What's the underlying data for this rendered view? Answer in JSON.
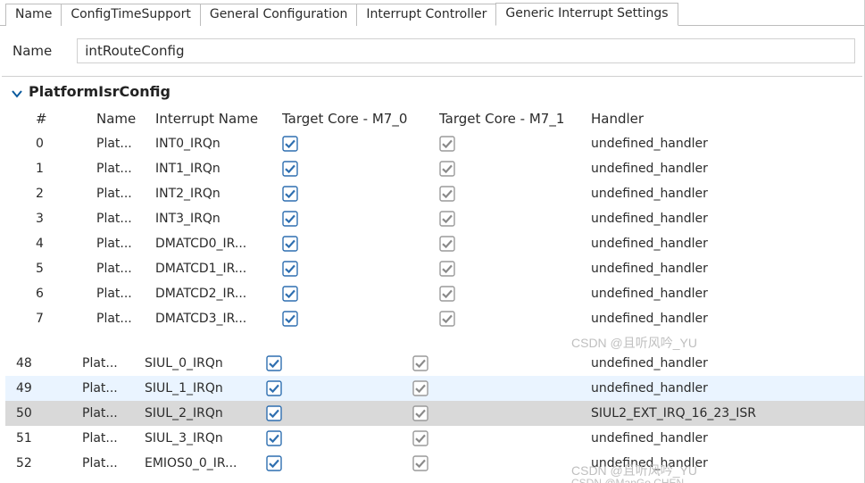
{
  "tabs": {
    "items": [
      "Name",
      "ConfigTimeSupport",
      "General Configuration",
      "Interrupt Controller",
      "Generic Interrupt Settings"
    ],
    "activeIndex": 4
  },
  "nameField": {
    "label": "Name",
    "value": "intRouteConfig"
  },
  "group": {
    "title": "PlatformIsrConfig",
    "expanded": true
  },
  "columns": {
    "idx": "#",
    "name": "Name",
    "int": "Interrupt Name",
    "t0": "Target Core - M7_0",
    "t1": "Target Core - M7_1",
    "hdl": "Handler"
  },
  "rowsTop": [
    {
      "idx": "0",
      "name": "Plat...",
      "int": "INT0_IRQn",
      "t0": true,
      "t1": true,
      "hdl": "undefined_handler"
    },
    {
      "idx": "1",
      "name": "Plat...",
      "int": "INT1_IRQn",
      "t0": true,
      "t1": true,
      "hdl": "undefined_handler"
    },
    {
      "idx": "2",
      "name": "Plat...",
      "int": "INT2_IRQn",
      "t0": true,
      "t1": true,
      "hdl": "undefined_handler"
    },
    {
      "idx": "3",
      "name": "Plat...",
      "int": "INT3_IRQn",
      "t0": true,
      "t1": true,
      "hdl": "undefined_handler"
    },
    {
      "idx": "4",
      "name": "Plat...",
      "int": "DMATCD0_IR...",
      "t0": true,
      "t1": true,
      "hdl": "undefined_handler"
    },
    {
      "idx": "5",
      "name": "Plat...",
      "int": "DMATCD1_IR...",
      "t0": true,
      "t1": true,
      "hdl": "undefined_handler"
    },
    {
      "idx": "6",
      "name": "Plat...",
      "int": "DMATCD2_IR...",
      "t0": true,
      "t1": true,
      "hdl": "undefined_handler"
    },
    {
      "idx": "7",
      "name": "Plat...",
      "int": "DMATCD3_IR...",
      "t0": true,
      "t1": true,
      "hdl": "undefined_handler"
    }
  ],
  "rowsBottom": [
    {
      "idx": "48",
      "name": "Plat...",
      "int": "SIUL_0_IRQn",
      "t0": true,
      "t1": true,
      "hdl": "undefined_handler"
    },
    {
      "idx": "49",
      "name": "Plat...",
      "int": "SIUL_1_IRQn",
      "t0": true,
      "t1": true,
      "hdl": "undefined_handler",
      "hl": true
    },
    {
      "idx": "50",
      "name": "Plat...",
      "int": "SIUL_2_IRQn",
      "t0": true,
      "t1": true,
      "hdl": "SIUL2_EXT_IRQ_16_23_ISR",
      "selected": true
    },
    {
      "idx": "51",
      "name": "Plat...",
      "int": "SIUL_3_IRQn",
      "t0": true,
      "t1": true,
      "hdl": "undefined_handler"
    },
    {
      "idx": "52",
      "name": "Plat...",
      "int": "EMIOS0_0_IR...",
      "t0": true,
      "t1": true,
      "hdl": "undefined_handler"
    }
  ],
  "watermarks": {
    "w1": "CSDN @且听风吟_YU",
    "w2": "CSDN @且听风吟_YU",
    "w3": "CSDN @ManGo CHEN"
  }
}
